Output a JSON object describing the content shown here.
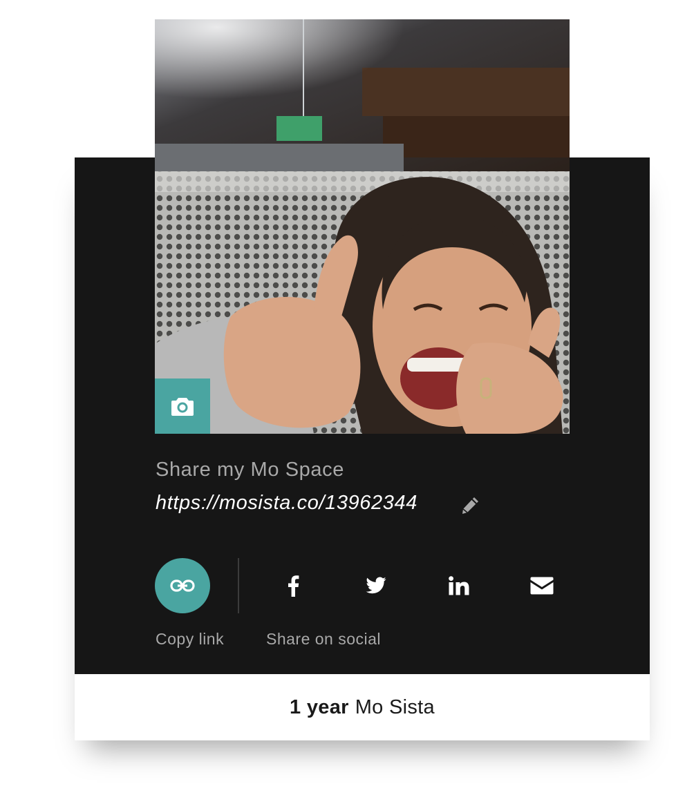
{
  "profile": {
    "photo_icon": "profile-photo",
    "change_photo_icon": "camera-icon"
  },
  "share": {
    "title": "Share my Mo Space",
    "url": "https://mosista.co/13962344",
    "edit_icon": "pencil-icon"
  },
  "actions": {
    "copy_link_label": "Copy link",
    "copy_link_icon": "link-icon",
    "share_social_label": "Share on social",
    "social_icons": [
      "facebook-icon",
      "twitter-icon",
      "linkedin-icon",
      "email-icon"
    ]
  },
  "footer": {
    "duration": "1 year",
    "role": "Mo Sista"
  },
  "colors": {
    "accent": "#4aa5a1",
    "card_background": "#161616",
    "muted_text": "#a9a9a9"
  }
}
